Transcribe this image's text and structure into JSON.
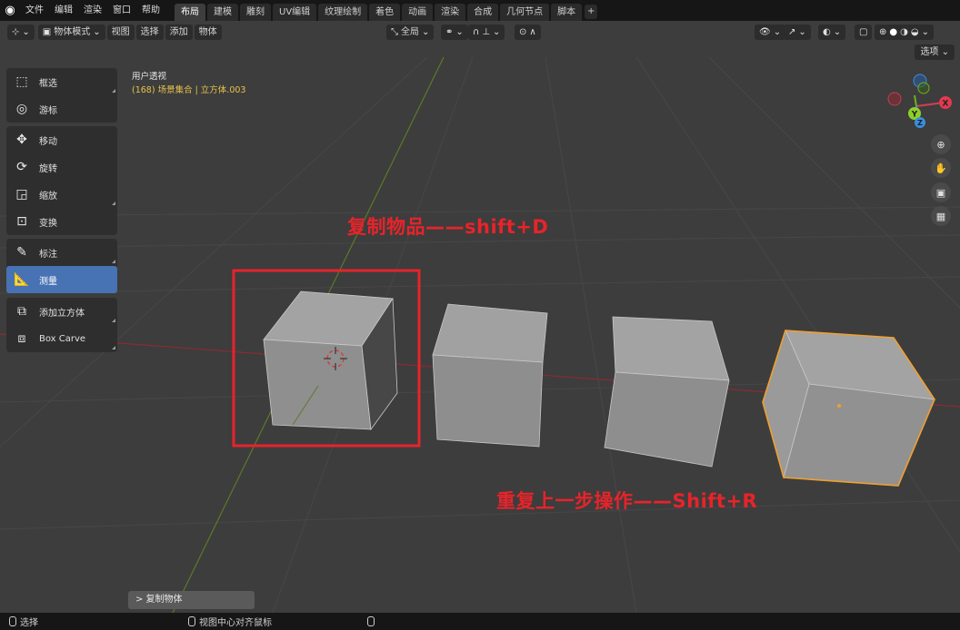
{
  "menu": {
    "file": "文件",
    "edit": "编辑",
    "render": "渲染",
    "window": "窗口",
    "help": "帮助"
  },
  "workspace_tabs": [
    "布局",
    "建模",
    "雕刻",
    "UV编辑",
    "纹理绘制",
    "着色",
    "动画",
    "渲染",
    "合成",
    "几何节点",
    "脚本"
  ],
  "active_tab": "布局",
  "add_tab": "+",
  "viewport_header": {
    "mode": "物体模式",
    "view": "视图",
    "select": "选择",
    "add": "添加",
    "object": "物体",
    "transform_orientation": "全局"
  },
  "options_label": "选项",
  "view_name": "用户透视",
  "scene_info": "(168) 场景集合 | 立方体.003",
  "tools": {
    "select_box": "框选",
    "cursor": "游标",
    "move": "移动",
    "rotate": "旋转",
    "scale": "缩放",
    "transform": "变换",
    "annotate": "标注",
    "measure": "测量",
    "add_cube": "添加立方体",
    "box_carve": "Box Carve"
  },
  "active_tool": "测量",
  "gizmo": {
    "y": "Y",
    "z": "Z",
    "x": "X"
  },
  "annotations": {
    "duplicate": "复制物品——shift+D",
    "repeat": "重复上一步操作——Shift+R"
  },
  "last_operation": "> 复制物体",
  "status": {
    "select": "选择",
    "center_view": "视图中心对齐鼠标"
  },
  "colors": {
    "annotation_red": "#e8232a",
    "selected_outline": "#f0a030",
    "active_tool": "#4772b3",
    "scene_info_yellow": "#e6c34d"
  }
}
